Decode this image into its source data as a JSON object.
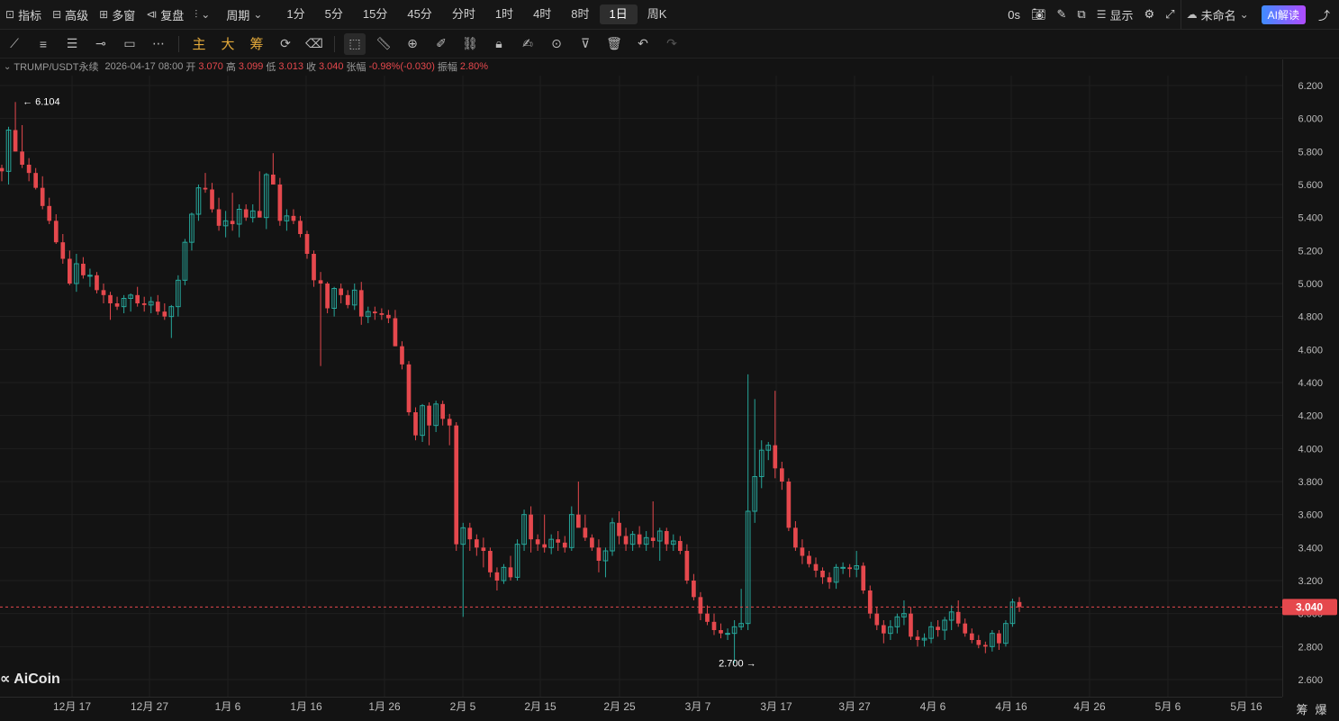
{
  "topbar": {
    "left": [
      {
        "icon": "chart-line-icon",
        "label": "指标"
      },
      {
        "icon": "layers-icon",
        "label": "高级"
      },
      {
        "icon": "grid-icon",
        "label": "多窗"
      },
      {
        "icon": "replay-icon",
        "label": "复盘"
      }
    ],
    "period_label": "周期",
    "periods": [
      "1分",
      "5分",
      "15分",
      "45分",
      "分时",
      "1时",
      "4时",
      "8时",
      "1日",
      "周K"
    ],
    "active_period": "1日",
    "right": {
      "countdown": "0s",
      "display_label": "显示",
      "layout_name": "未命名",
      "ai_label": "AI解读"
    }
  },
  "toolbar": {
    "indicator_tabs": [
      "主",
      "大",
      "筹"
    ]
  },
  "info": {
    "symbol": "TRUMP/USDT永续",
    "datetime": "2026-04-17 08:00",
    "open_label": "开",
    "open": "3.070",
    "high_label": "高",
    "high": "3.099",
    "low_label": "低",
    "low": "3.013",
    "close_label": "收",
    "close": "3.040",
    "change_label": "张幅",
    "change": "-0.98%(-0.030)",
    "amplitude_label": "振幅",
    "amplitude": "2.80%"
  },
  "watermark": "AiCoin",
  "bottom_right": [
    "筹",
    "爆"
  ],
  "chart_data": {
    "type": "candlestick",
    "price_axis": {
      "min": 2.6,
      "max": 6.2,
      "step": 0.2,
      "ticks": [
        "6.200",
        "6.000",
        "5.800",
        "5.600",
        "5.400",
        "5.200",
        "5.000",
        "4.800",
        "4.600",
        "4.400",
        "4.200",
        "4.000",
        "3.800",
        "3.600",
        "3.400",
        "3.200",
        "3.000",
        "2.800",
        "2.600"
      ]
    },
    "date_axis": [
      "12月 17",
      "12月 27",
      "1月 6",
      "1月 16",
      "1月 26",
      "2月 5",
      "2月 15",
      "2月 25",
      "3月 7",
      "3月 17",
      "3月 27",
      "4月 6",
      "4月 16",
      "4月 26",
      "5月 6",
      "5月 16"
    ],
    "current_price": "3.040",
    "high_marker": "6.104",
    "low_marker": "2.700",
    "colors": {
      "up": "#26a69a",
      "down": "#e5484d",
      "background": "#131313",
      "grid": "#1f1f1f",
      "price_line": "#e5484d"
    },
    "candles": [
      [
        5.7,
        5.72,
        5.62,
        5.68
      ],
      [
        5.68,
        5.95,
        5.6,
        5.93
      ],
      [
        5.93,
        6.1,
        5.8,
        5.8
      ],
      [
        5.8,
        5.96,
        5.7,
        5.72
      ],
      [
        5.72,
        5.76,
        5.62,
        5.67
      ],
      [
        5.67,
        5.7,
        5.57,
        5.58
      ],
      [
        5.58,
        5.65,
        5.45,
        5.47
      ],
      [
        5.47,
        5.52,
        5.36,
        5.38
      ],
      [
        5.38,
        5.42,
        5.24,
        5.25
      ],
      [
        5.25,
        5.3,
        5.12,
        5.15
      ],
      [
        5.15,
        5.2,
        4.99,
        5.0
      ],
      [
        5.0,
        5.18,
        4.95,
        5.12
      ],
      [
        5.12,
        5.16,
        5.03,
        5.05
      ],
      [
        5.05,
        5.09,
        4.98,
        5.05
      ],
      [
        5.05,
        5.07,
        4.94,
        4.96
      ],
      [
        4.96,
        5.0,
        4.88,
        4.93
      ],
      [
        4.93,
        4.95,
        4.78,
        4.88
      ],
      [
        4.88,
        4.92,
        4.84,
        4.86
      ],
      [
        4.86,
        4.93,
        4.82,
        4.91
      ],
      [
        4.91,
        4.94,
        4.83,
        4.93
      ],
      [
        4.93,
        4.98,
        4.86,
        4.88
      ],
      [
        4.88,
        4.92,
        4.83,
        4.87
      ],
      [
        4.87,
        4.92,
        4.82,
        4.89
      ],
      [
        4.89,
        4.93,
        4.81,
        4.83
      ],
      [
        4.83,
        4.88,
        4.78,
        4.8
      ],
      [
        4.8,
        4.87,
        4.67,
        4.86
      ],
      [
        4.86,
        5.05,
        4.8,
        5.02
      ],
      [
        5.02,
        5.27,
        4.99,
        5.25
      ],
      [
        5.25,
        5.43,
        5.2,
        5.42
      ],
      [
        5.42,
        5.6,
        5.38,
        5.58
      ],
      [
        5.58,
        5.67,
        5.55,
        5.57
      ],
      [
        5.57,
        5.61,
        5.43,
        5.45
      ],
      [
        5.45,
        5.52,
        5.32,
        5.35
      ],
      [
        5.35,
        5.44,
        5.28,
        5.38
      ],
      [
        5.38,
        5.55,
        5.32,
        5.36
      ],
      [
        5.36,
        5.48,
        5.28,
        5.45
      ],
      [
        5.45,
        5.48,
        5.38,
        5.4
      ],
      [
        5.4,
        5.48,
        5.37,
        5.44
      ],
      [
        5.44,
        5.68,
        5.4,
        5.4
      ],
      [
        5.4,
        5.67,
        5.33,
        5.66
      ],
      [
        5.66,
        5.79,
        5.6,
        5.6
      ],
      [
        5.6,
        5.64,
        5.35,
        5.38
      ],
      [
        5.38,
        5.45,
        5.32,
        5.41
      ],
      [
        5.41,
        5.45,
        5.36,
        5.38
      ],
      [
        5.38,
        5.41,
        5.28,
        5.3
      ],
      [
        5.3,
        5.32,
        5.15,
        5.18
      ],
      [
        5.18,
        5.2,
        4.98,
        5.02
      ],
      [
        5.02,
        5.07,
        4.5,
        5.0
      ],
      [
        5.0,
        5.01,
        4.82,
        4.85
      ],
      [
        4.85,
        4.98,
        4.8,
        4.97
      ],
      [
        4.97,
        5.0,
        4.88,
        4.93
      ],
      [
        4.93,
        4.96,
        4.85,
        4.87
      ],
      [
        4.87,
        5.0,
        4.84,
        4.96
      ],
      [
        4.96,
        5.01,
        4.75,
        4.8
      ],
      [
        4.8,
        4.86,
        4.76,
        4.83
      ],
      [
        4.83,
        4.86,
        4.78,
        4.82
      ],
      [
        4.82,
        4.85,
        4.78,
        4.81
      ],
      [
        4.81,
        4.84,
        4.76,
        4.79
      ],
      [
        4.79,
        4.84,
        4.62,
        4.62
      ],
      [
        4.62,
        4.65,
        4.48,
        4.51
      ],
      [
        4.51,
        4.53,
        4.2,
        4.22
      ],
      [
        4.22,
        4.25,
        4.05,
        4.08
      ],
      [
        4.08,
        4.27,
        4.04,
        4.26
      ],
      [
        4.26,
        4.28,
        4.02,
        4.14
      ],
      [
        4.14,
        4.29,
        4.1,
        4.27
      ],
      [
        4.27,
        4.29,
        4.14,
        4.18
      ],
      [
        4.18,
        4.21,
        4.02,
        4.14
      ],
      [
        4.14,
        4.16,
        3.38,
        3.42
      ],
      [
        3.42,
        3.55,
        2.98,
        3.52
      ],
      [
        3.52,
        3.55,
        3.38,
        3.45
      ],
      [
        3.45,
        3.48,
        3.35,
        3.4
      ],
      [
        3.4,
        3.46,
        3.28,
        3.38
      ],
      [
        3.38,
        3.4,
        3.22,
        3.25
      ],
      [
        3.25,
        3.28,
        3.14,
        3.2
      ],
      [
        3.2,
        3.3,
        3.18,
        3.28
      ],
      [
        3.28,
        3.35,
        3.2,
        3.22
      ],
      [
        3.22,
        3.45,
        3.2,
        3.42
      ],
      [
        3.42,
        3.63,
        3.38,
        3.6
      ],
      [
        3.6,
        3.65,
        3.37,
        3.45
      ],
      [
        3.45,
        3.48,
        3.38,
        3.42
      ],
      [
        3.42,
        3.6,
        3.37,
        3.4
      ],
      [
        3.4,
        3.48,
        3.36,
        3.45
      ],
      [
        3.45,
        3.5,
        3.38,
        3.43
      ],
      [
        3.43,
        3.47,
        3.37,
        3.4
      ],
      [
        3.4,
        3.65,
        3.38,
        3.6
      ],
      [
        3.6,
        3.8,
        3.55,
        3.52
      ],
      [
        3.52,
        3.6,
        3.44,
        3.46
      ],
      [
        3.46,
        3.48,
        3.38,
        3.4
      ],
      [
        3.4,
        3.45,
        3.25,
        3.32
      ],
      [
        3.32,
        3.4,
        3.22,
        3.38
      ],
      [
        3.38,
        3.58,
        3.35,
        3.55
      ],
      [
        3.55,
        3.62,
        3.42,
        3.47
      ],
      [
        3.47,
        3.52,
        3.38,
        3.42
      ],
      [
        3.42,
        3.5,
        3.38,
        3.48
      ],
      [
        3.48,
        3.53,
        3.4,
        3.42
      ],
      [
        3.42,
        3.5,
        3.38,
        3.46
      ],
      [
        3.46,
        3.68,
        3.4,
        3.44
      ],
      [
        3.44,
        3.52,
        3.32,
        3.5
      ],
      [
        3.5,
        3.52,
        3.38,
        3.42
      ],
      [
        3.42,
        3.48,
        3.38,
        3.44
      ],
      [
        3.44,
        3.47,
        3.36,
        3.38
      ],
      [
        3.38,
        3.42,
        3.18,
        3.2
      ],
      [
        3.2,
        3.24,
        3.08,
        3.1
      ],
      [
        3.1,
        3.13,
        2.96,
        3.0
      ],
      [
        3.0,
        3.05,
        2.93,
        2.95
      ],
      [
        2.95,
        3.0,
        2.87,
        2.9
      ],
      [
        2.9,
        2.94,
        2.85,
        2.88
      ],
      [
        2.88,
        2.91,
        2.84,
        2.88
      ],
      [
        2.88,
        2.96,
        2.7,
        2.92
      ],
      [
        2.92,
        3.15,
        2.9,
        2.94
      ],
      [
        2.94,
        4.45,
        2.9,
        3.62
      ],
      [
        3.62,
        4.3,
        3.55,
        3.83
      ],
      [
        3.83,
        4.05,
        3.76,
        3.99
      ],
      [
        3.99,
        4.04,
        3.93,
        4.02
      ],
      [
        4.02,
        4.35,
        3.82,
        3.88
      ],
      [
        3.88,
        3.92,
        3.75,
        3.8
      ],
      [
        3.8,
        3.82,
        3.5,
        3.52
      ],
      [
        3.52,
        3.56,
        3.38,
        3.4
      ],
      [
        3.4,
        3.45,
        3.3,
        3.35
      ],
      [
        3.35,
        3.38,
        3.28,
        3.3
      ],
      [
        3.3,
        3.34,
        3.22,
        3.26
      ],
      [
        3.26,
        3.28,
        3.18,
        3.22
      ],
      [
        3.22,
        3.25,
        3.15,
        3.19
      ],
      [
        3.19,
        3.3,
        3.15,
        3.28
      ],
      [
        3.28,
        3.31,
        3.24,
        3.28
      ],
      [
        3.28,
        3.3,
        3.22,
        3.27
      ],
      [
        3.27,
        3.38,
        3.22,
        3.29
      ],
      [
        3.29,
        3.31,
        3.12,
        3.14
      ],
      [
        3.14,
        3.17,
        2.97,
        3.0
      ],
      [
        3.0,
        3.04,
        2.9,
        2.93
      ],
      [
        2.93,
        2.96,
        2.82,
        2.88
      ],
      [
        2.88,
        2.96,
        2.84,
        2.92
      ],
      [
        2.92,
        3.0,
        2.88,
        2.98
      ],
      [
        2.98,
        3.08,
        2.93,
        3.0
      ],
      [
        3.0,
        3.04,
        2.84,
        2.86
      ],
      [
        2.86,
        2.9,
        2.8,
        2.84
      ],
      [
        2.84,
        2.88,
        2.8,
        2.85
      ],
      [
        2.85,
        2.95,
        2.82,
        2.92
      ],
      [
        2.92,
        2.96,
        2.86,
        2.9
      ],
      [
        2.9,
        2.98,
        2.84,
        2.96
      ],
      [
        2.96,
        3.05,
        2.9,
        3.01
      ],
      [
        3.01,
        3.08,
        2.92,
        2.94
      ],
      [
        2.94,
        2.97,
        2.86,
        2.88
      ],
      [
        2.88,
        2.91,
        2.82,
        2.84
      ],
      [
        2.84,
        2.87,
        2.79,
        2.81
      ],
      [
        2.81,
        2.83,
        2.76,
        2.8
      ],
      [
        2.8,
        2.9,
        2.77,
        2.88
      ],
      [
        2.88,
        2.9,
        2.78,
        2.82
      ],
      [
        2.82,
        2.96,
        2.8,
        2.94
      ],
      [
        2.94,
        3.09,
        2.92,
        3.07
      ],
      [
        3.07,
        3.1,
        3.01,
        3.04
      ]
    ]
  }
}
